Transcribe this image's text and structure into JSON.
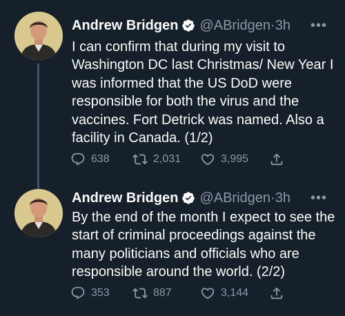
{
  "colors": {
    "background": "#15202b",
    "text_primary": "#ffffff",
    "text_secondary": "#8b98a5",
    "thread_line": "#3d5466"
  },
  "tweets": [
    {
      "name": "Andrew Bridgen",
      "handle": "@ABridgen",
      "separator": "·",
      "time": "3h",
      "text": "I can confirm that during my visit to Washington DC last Christmas/ New Year I was informed that the US DoD were responsible for both the virus and the vaccines. Fort Detrick was named. Also a facility in Canada. (1/2)",
      "replies": "638",
      "retweets": "2,031",
      "likes": "3,995"
    },
    {
      "name": "Andrew Bridgen",
      "handle": "@ABridgen",
      "separator": "·",
      "time": "3h",
      "text": "By the end of the month I expect to see the start of criminal proceedings against the many politicians and officials who are responsible around the world. (2/2)",
      "replies": "353",
      "retweets": "887",
      "likes": "3,144"
    }
  ],
  "icons": {
    "verified": "verified-badge-icon",
    "more": "more-options-icon",
    "reply": "reply-icon",
    "retweet": "retweet-icon",
    "like": "like-icon",
    "share": "share-icon"
  }
}
